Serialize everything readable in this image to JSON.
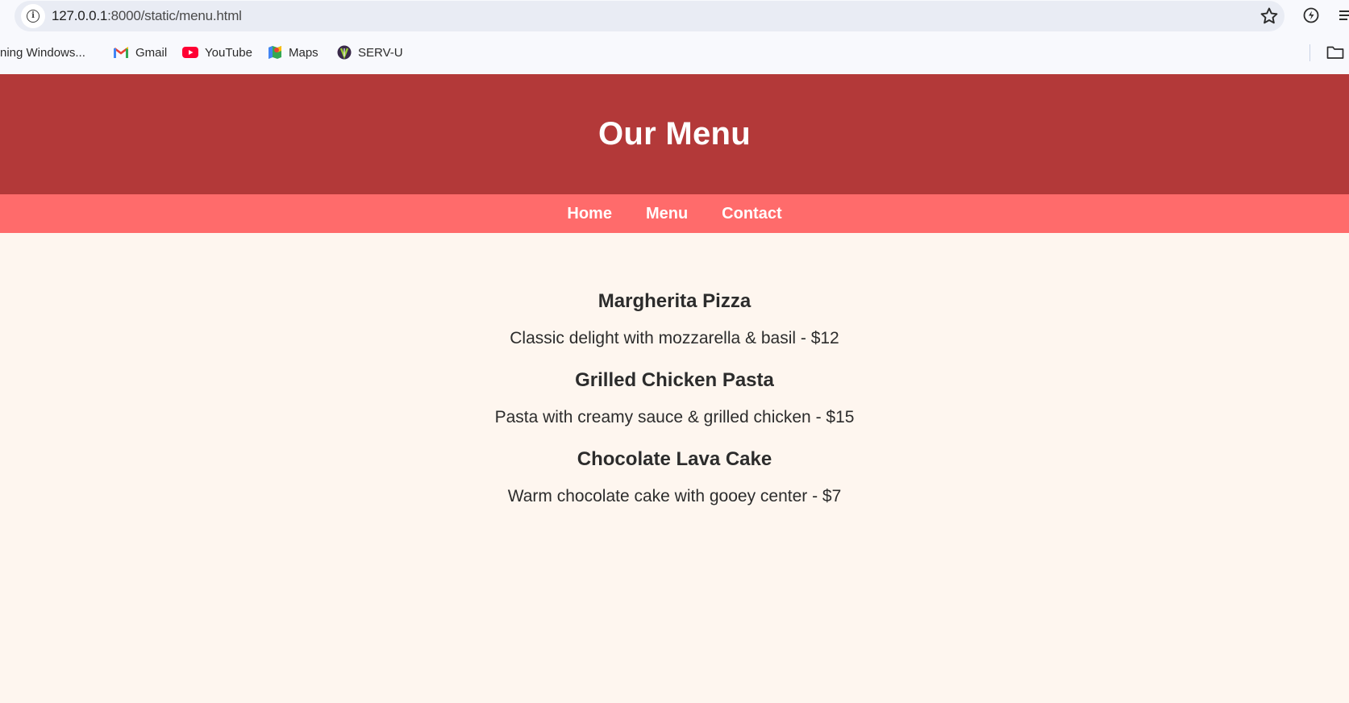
{
  "browser": {
    "url_host": "127.0.0.1",
    "url_path": ":8000/static/menu.html",
    "bookmarks": [
      {
        "label": "ning Windows...",
        "icon": "none"
      },
      {
        "label": "Gmail",
        "icon": "gmail-icon"
      },
      {
        "label": "YouTube",
        "icon": "youtube-icon"
      },
      {
        "label": "Maps",
        "icon": "maps-icon"
      },
      {
        "label": "SERV-U",
        "icon": "servu-icon"
      }
    ]
  },
  "header": {
    "title": "Our Menu"
  },
  "nav": {
    "links": [
      "Home",
      "Menu",
      "Contact"
    ]
  },
  "menu": {
    "items": [
      {
        "name": "Margherita Pizza",
        "description": "Classic delight with mozzarella & basil - $12"
      },
      {
        "name": "Grilled Chicken Pasta",
        "description": "Pasta with creamy sauce & grilled chicken - $15"
      },
      {
        "name": "Chocolate Lava Cake",
        "description": "Warm chocolate cake with gooey center - $7"
      }
    ]
  },
  "colors": {
    "header_bg": "#b33939",
    "nav_bg": "#ff6b6b",
    "page_bg": "#fef6ef",
    "text": "#2c2c2c"
  }
}
